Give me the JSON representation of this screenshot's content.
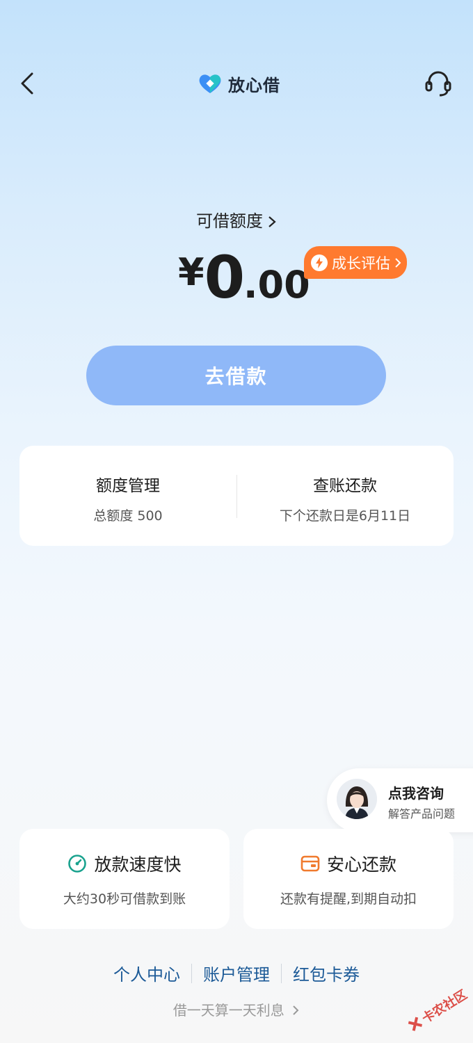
{
  "header": {
    "brand_name": "放心借",
    "back_icon": "chevron-left-icon",
    "service_icon": "headset-icon"
  },
  "credit": {
    "label": "可借额度",
    "currency": "¥",
    "integer": "0",
    "decimal": ".00",
    "growth_badge": "成长评估"
  },
  "borrow_button": "去借款",
  "manage": {
    "left_title": "额度管理",
    "left_sub": "总额度 500",
    "right_title": "查账还款",
    "right_sub": "下个还款日是6月11日"
  },
  "consult": {
    "title": "点我咨询",
    "subtitle": "解答产品问题"
  },
  "features": [
    {
      "title": "放款速度快",
      "subtitle": "大约30秒可借款到账",
      "icon": "speed-gauge-icon"
    },
    {
      "title": "安心还款",
      "subtitle": "还款有提醒,到期自动扣",
      "icon": "wallet-card-icon"
    }
  ],
  "links": [
    "个人中心",
    "账户管理",
    "红包卡券"
  ],
  "footnote": "借一天算一天利息",
  "watermark": "卡农社区",
  "colors": {
    "accent_orange": "#ff7a2f",
    "button_blue": "#8fb8f8",
    "link_blue": "#1c5a97",
    "green_icon": "#19a28e"
  }
}
